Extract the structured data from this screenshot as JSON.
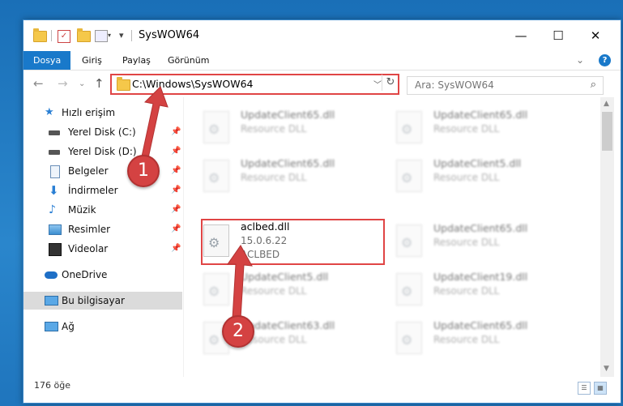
{
  "window": {
    "title": "SysWOW64",
    "controls": {
      "minimize": "—",
      "maximize": "☐",
      "close": "✕"
    }
  },
  "ribbon": {
    "tabs": [
      "Dosya",
      "Giriş",
      "Paylaş",
      "Görünüm"
    ],
    "help": "?",
    "collapse": "⌄"
  },
  "nav": {
    "back": "←",
    "forward": "→",
    "recent": "⌄",
    "up": "↑",
    "address": "C:\\Windows\\SysWOW64",
    "search_placeholder": "Ara: SysWOW64"
  },
  "sidebar": {
    "items": [
      {
        "label": "Hızlı erişim",
        "icon": "star-icon"
      },
      {
        "label": "Yerel Disk (C:)",
        "icon": "drive-icon"
      },
      {
        "label": "Yerel Disk (D:)",
        "icon": "drive-icon"
      },
      {
        "label": "Belgeler",
        "icon": "documents-icon"
      },
      {
        "label": "İndirmeler",
        "icon": "download-icon"
      },
      {
        "label": "Müzik",
        "icon": "music-icon"
      },
      {
        "label": "Resimler",
        "icon": "pictures-icon"
      },
      {
        "label": "Videolar",
        "icon": "video-icon"
      },
      {
        "label": "OneDrive",
        "icon": "cloud-icon"
      },
      {
        "label": "Bu bilgisayar",
        "icon": "computer-icon"
      },
      {
        "label": "Ağ",
        "icon": "network-icon"
      }
    ]
  },
  "files": [
    {
      "name": "UpdateClient65.dll",
      "type": "Resource DLL"
    },
    {
      "name": "UpdateClient65.dll",
      "type": "Resource DLL"
    },
    {
      "name": "UpdateClient65.dll",
      "type": "Resource DLL"
    },
    {
      "name": "UpdateClient5.dll",
      "type": "Resource DLL"
    },
    {
      "name": "aclbed.dll",
      "version": "15.0.6.22",
      "type": "ACLBED"
    },
    {
      "name": "UpdateClient65.dll",
      "type": "Resource DLL"
    },
    {
      "name": "UpdateClient5.dll",
      "type": "Resource DLL"
    },
    {
      "name": "UpdateClient19.dll",
      "type": "Resource DLL"
    },
    {
      "name": "UpdateClient63.dll",
      "type": "Resource DLL"
    },
    {
      "name": "UpdateClient65.dll",
      "type": "Resource DLL"
    }
  ],
  "callouts": [
    "1",
    "2"
  ],
  "status": {
    "count": "176 öğe"
  },
  "colors": {
    "accent": "#1979ca",
    "highlight": "#e04545",
    "desktop": "#1d6fb4"
  }
}
